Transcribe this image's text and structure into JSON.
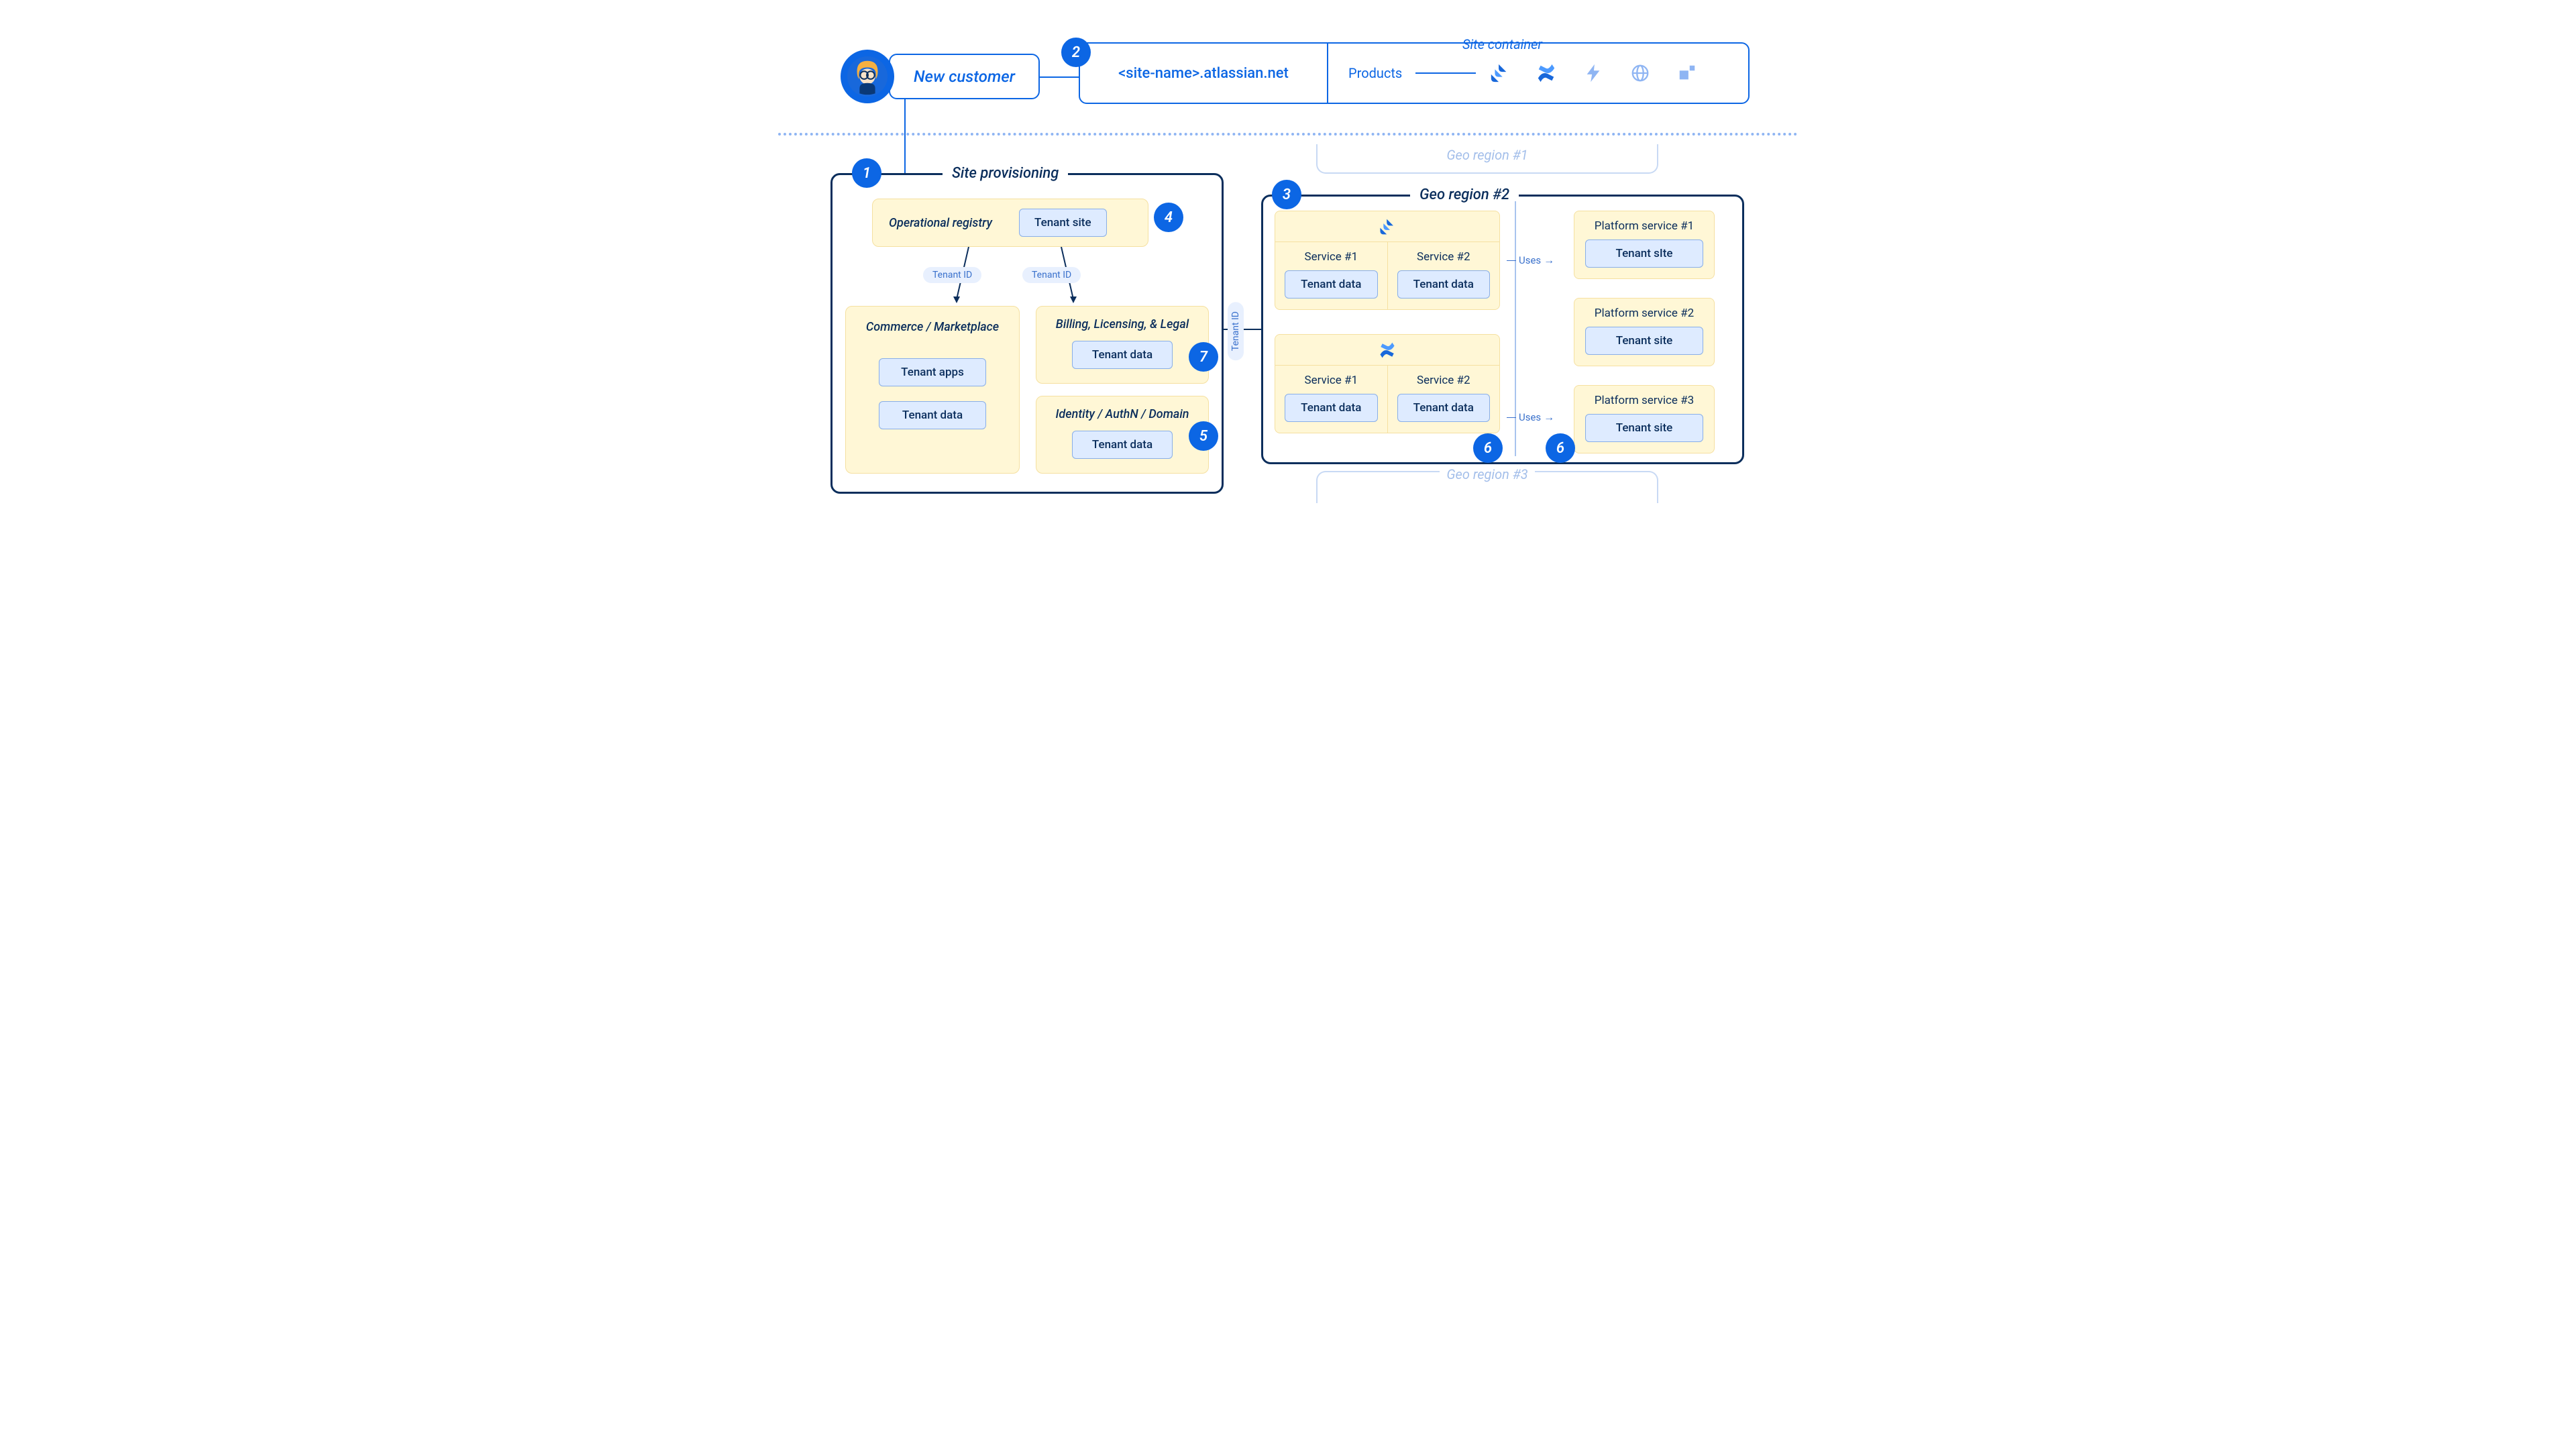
{
  "top": {
    "new_customer": "New customer",
    "site_container_label": "Site container",
    "site_url": "<site-name>.atlassian.net",
    "products_label": "Products"
  },
  "markers": {
    "m1": "1",
    "m2": "2",
    "m3": "3",
    "m4": "4",
    "m5": "5",
    "m6a": "6",
    "m6b": "6",
    "m7": "7"
  },
  "provisioning": {
    "title": "Site provisioning",
    "registry": {
      "title": "Operational registry",
      "tenant_site": "Tenant site"
    },
    "tenant_id_a": "Tenant ID",
    "tenant_id_b": "Tenant ID",
    "commerce": {
      "title": "Commerce / Marketplace",
      "apps": "Tenant apps",
      "data": "Tenant data"
    },
    "billing": {
      "title": "Billing, Licensing, & Legal",
      "data": "Tenant data"
    },
    "identity": {
      "title": "Identity / AuthN / Domain",
      "data": "Tenant data"
    }
  },
  "tenant_id_cross": "Tenant ID",
  "geo": {
    "ghost_top": "Geo region #1",
    "title": "Geo region #2",
    "ghost_bot": "Geo region #3",
    "uses_a": "Uses",
    "uses_b": "Uses",
    "jira": {
      "s1": "Service #1",
      "s1_data": "Tenant data",
      "s2": "Service #2",
      "s2_data": "Tenant data"
    },
    "confluence": {
      "s1": "Service #1",
      "s1_data": "Tenant data",
      "s2": "Service #2",
      "s2_data": "Tenant data"
    },
    "plat1": {
      "title": "Platform service #1",
      "data": "Tenant sIte"
    },
    "plat2": {
      "title": "Platform service #2",
      "data": "Tenant site"
    },
    "plat3": {
      "title": "Platform service #3",
      "data": "Tenant site"
    }
  }
}
